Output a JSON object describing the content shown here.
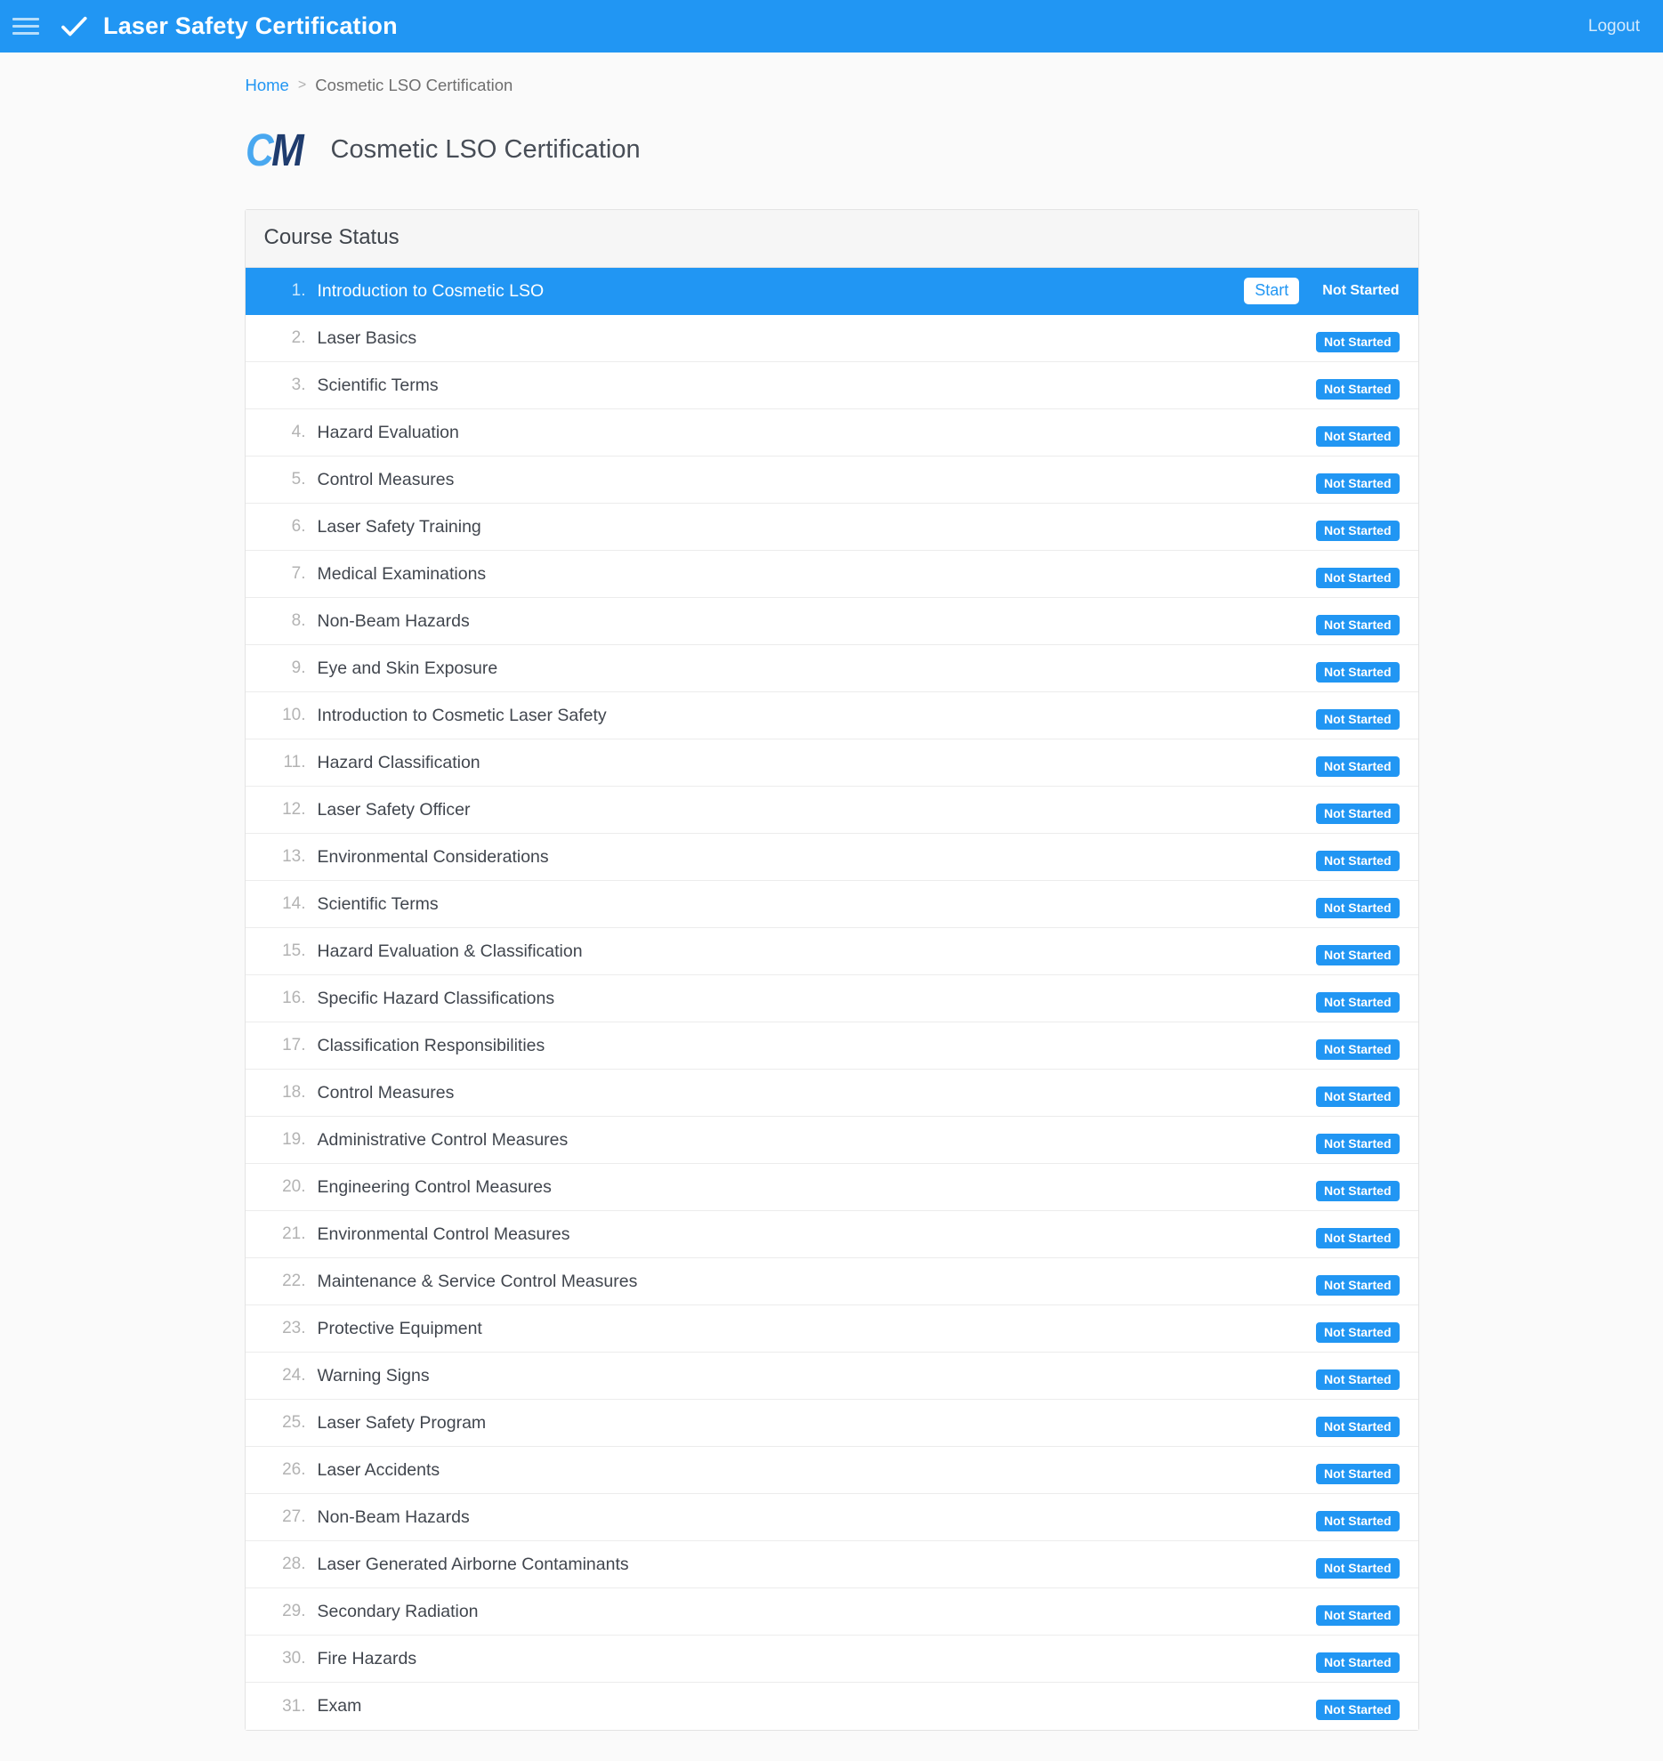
{
  "appbar": {
    "menu_icon": "hamburger-menu-icon",
    "brand_icon": "checkmark-icon",
    "title": "Laser Safety Certification",
    "logout_label": "Logout"
  },
  "breadcrumb": {
    "home_label": "Home",
    "separator": ">",
    "current_label": "Cosmetic LSO Certification"
  },
  "header": {
    "logo_c": "C",
    "logo_m": "M",
    "page_title": "Cosmetic LSO Certification"
  },
  "panel": {
    "header_label": "Course Status"
  },
  "active_row": {
    "start_label": "Start",
    "status_label": "Not Started"
  },
  "colors": {
    "accent": "#2196f3",
    "badge": "#2196f3",
    "logo_c": "#49a8f0",
    "logo_m": "#1f3c6e",
    "panel_header_bg": "#f6f6f6",
    "page_bg": "#fafafa"
  },
  "courses": [
    {
      "num": "1.",
      "title": "Introduction to Cosmetic LSO",
      "status": "Not Started",
      "active": true
    },
    {
      "num": "2.",
      "title": "Laser Basics",
      "status": "Not Started",
      "active": false
    },
    {
      "num": "3.",
      "title": "Scientific Terms",
      "status": "Not Started",
      "active": false
    },
    {
      "num": "4.",
      "title": "Hazard Evaluation",
      "status": "Not Started",
      "active": false
    },
    {
      "num": "5.",
      "title": "Control Measures",
      "status": "Not Started",
      "active": false
    },
    {
      "num": "6.",
      "title": "Laser Safety Training",
      "status": "Not Started",
      "active": false
    },
    {
      "num": "7.",
      "title": "Medical Examinations",
      "status": "Not Started",
      "active": false
    },
    {
      "num": "8.",
      "title": "Non-Beam Hazards",
      "status": "Not Started",
      "active": false
    },
    {
      "num": "9.",
      "title": "Eye and Skin Exposure",
      "status": "Not Started",
      "active": false
    },
    {
      "num": "10.",
      "title": "Introduction to Cosmetic Laser Safety",
      "status": "Not Started",
      "active": false
    },
    {
      "num": "11.",
      "title": "Hazard Classification",
      "status": "Not Started",
      "active": false
    },
    {
      "num": "12.",
      "title": "Laser Safety Officer",
      "status": "Not Started",
      "active": false
    },
    {
      "num": "13.",
      "title": "Environmental Considerations",
      "status": "Not Started",
      "active": false
    },
    {
      "num": "14.",
      "title": "Scientific Terms",
      "status": "Not Started",
      "active": false
    },
    {
      "num": "15.",
      "title": "Hazard Evaluation & Classification",
      "status": "Not Started",
      "active": false
    },
    {
      "num": "16.",
      "title": "Specific Hazard Classifications",
      "status": "Not Started",
      "active": false
    },
    {
      "num": "17.",
      "title": "Classification Responsibilities",
      "status": "Not Started",
      "active": false
    },
    {
      "num": "18.",
      "title": "Control Measures",
      "status": "Not Started",
      "active": false
    },
    {
      "num": "19.",
      "title": "Administrative Control Measures",
      "status": "Not Started",
      "active": false
    },
    {
      "num": "20.",
      "title": "Engineering Control Measures",
      "status": "Not Started",
      "active": false
    },
    {
      "num": "21.",
      "title": "Environmental Control Measures",
      "status": "Not Started",
      "active": false
    },
    {
      "num": "22.",
      "title": "Maintenance & Service Control Measures",
      "status": "Not Started",
      "active": false
    },
    {
      "num": "23.",
      "title": "Protective Equipment",
      "status": "Not Started",
      "active": false
    },
    {
      "num": "24.",
      "title": "Warning Signs",
      "status": "Not Started",
      "active": false
    },
    {
      "num": "25.",
      "title": "Laser Safety Program",
      "status": "Not Started",
      "active": false
    },
    {
      "num": "26.",
      "title": "Laser Accidents",
      "status": "Not Started",
      "active": false
    },
    {
      "num": "27.",
      "title": "Non-Beam Hazards",
      "status": "Not Started",
      "active": false
    },
    {
      "num": "28.",
      "title": "Laser Generated Airborne Contaminants",
      "status": "Not Started",
      "active": false
    },
    {
      "num": "29.",
      "title": "Secondary Radiation",
      "status": "Not Started",
      "active": false
    },
    {
      "num": "30.",
      "title": "Fire Hazards",
      "status": "Not Started",
      "active": false
    },
    {
      "num": "31.",
      "title": "Exam",
      "status": "Not Started",
      "active": false
    }
  ]
}
